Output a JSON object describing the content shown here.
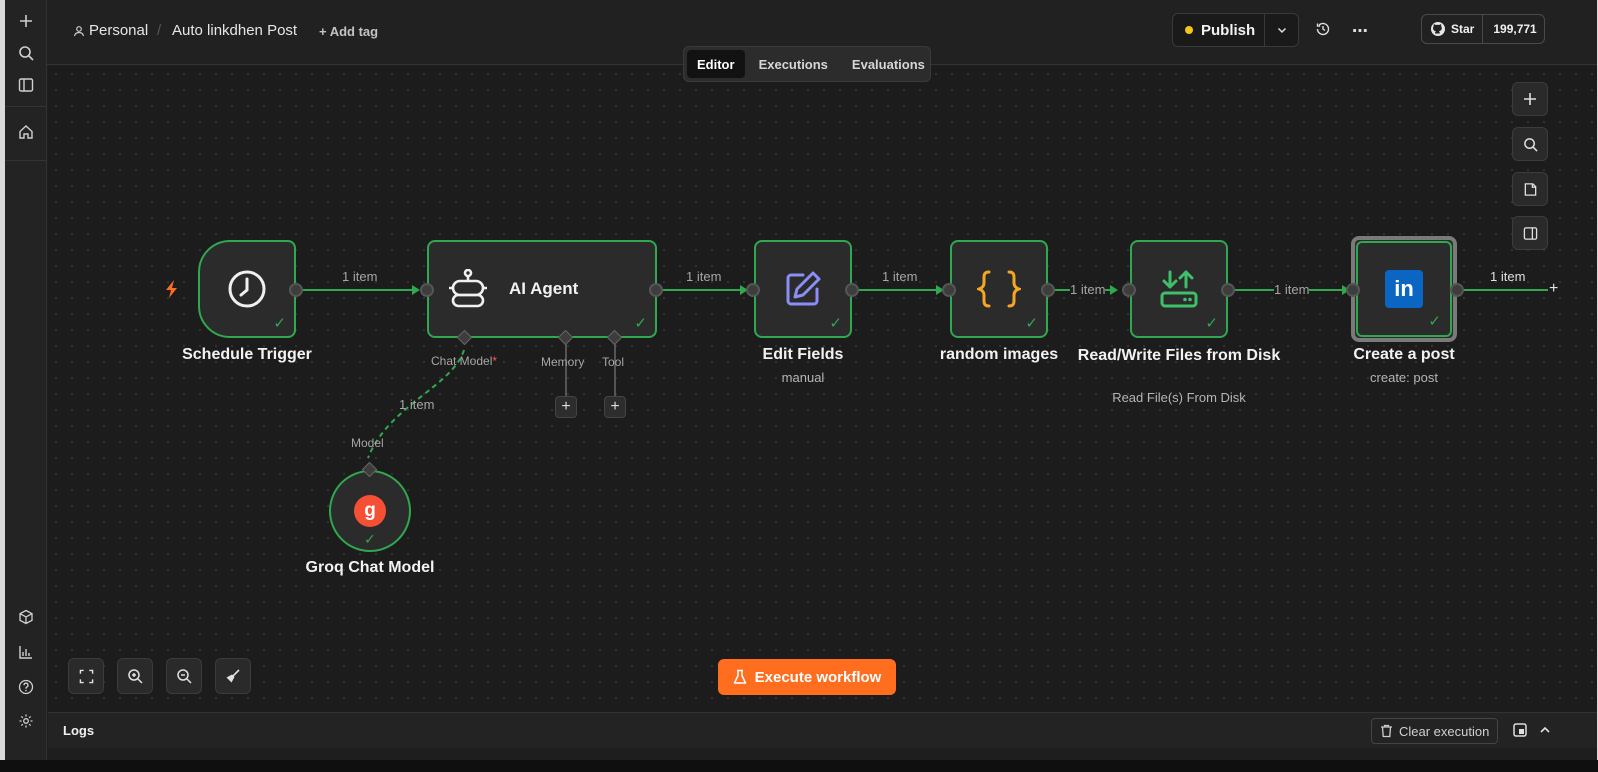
{
  "sidebar": {
    "items": [
      {
        "icon": "plus-icon"
      },
      {
        "icon": "search-icon"
      },
      {
        "icon": "panel-icon"
      },
      {
        "icon": "home-icon"
      },
      {
        "icon": "templates-icon"
      },
      {
        "icon": "insights-icon"
      },
      {
        "icon": "help-icon"
      },
      {
        "icon": "settings-icon"
      }
    ]
  },
  "header": {
    "project": "Personal",
    "separator": "/",
    "workflow_name": "Auto linkdhen Post",
    "add_tag": "+ Add tag",
    "tabs": [
      {
        "label": "Editor",
        "active": true
      },
      {
        "label": "Executions",
        "active": false
      },
      {
        "label": "Evaluations",
        "active": false
      }
    ],
    "publish_label": "Publish",
    "github": {
      "star_label": "Star",
      "count": "199,771"
    }
  },
  "workflow": {
    "trigger_icon": "bolt-icon",
    "nodes": [
      {
        "id": "schedule",
        "title": "Schedule Trigger",
        "subtitle": "",
        "icon": "clock-icon"
      },
      {
        "id": "agent",
        "title": "AI Agent",
        "subtitle": "",
        "icon": "robot-icon"
      },
      {
        "id": "edit",
        "title": "Edit Fields",
        "subtitle": "manual",
        "icon": "pencil-icon"
      },
      {
        "id": "random",
        "title": "random images",
        "subtitle": "",
        "icon": "braces-icon"
      },
      {
        "id": "readwrite",
        "title": "Read/Write Files from Disk",
        "subtitle": "Read File(s) From Disk",
        "icon": "file-transfer-icon"
      },
      {
        "id": "post",
        "title": "Create a post",
        "subtitle": "create: post",
        "icon": "linkedin-icon"
      },
      {
        "id": "groq",
        "title": "Groq Chat Model",
        "subtitle": "",
        "icon": "groq-icon"
      }
    ],
    "agent_ports": {
      "chat_model": "Chat Model",
      "required_mark": "*",
      "memory": "Memory",
      "tool": "Tool",
      "model": "Model"
    },
    "edge_labels": [
      "1 item",
      "1 item",
      "1 item",
      "1 item",
      "1 item",
      "1 item",
      "1 item"
    ],
    "execute_label": "Execute workflow"
  },
  "logs": {
    "title": "Logs",
    "clear_label": "Clear execution"
  },
  "colors": {
    "success": "#2fa84f",
    "accent": "#ff6d1f",
    "publish_dot": "#f5c518",
    "linkedin": "#0a66c2",
    "groq": "#f55036"
  }
}
